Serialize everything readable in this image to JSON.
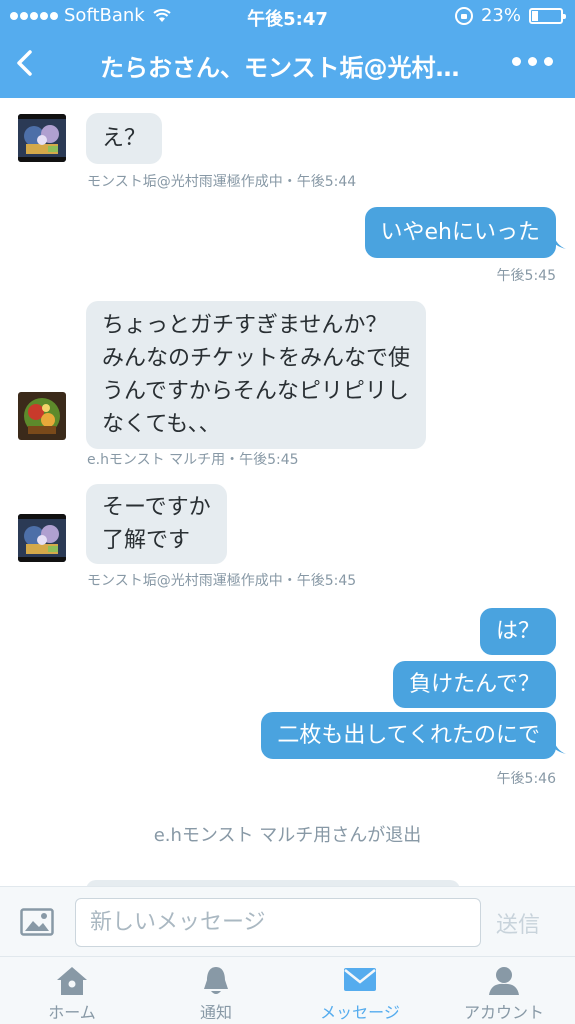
{
  "status_bar": {
    "carrier": "SoftBank",
    "time": "午後5:47",
    "battery_percent": "23%",
    "battery_level": 0.23
  },
  "header": {
    "title": "たらおさん、モンスト垢@光村雨運極作成中"
  },
  "messages": [
    {
      "text": "え？",
      "meta": "モンスト垢@光村雨運極作成中・午後5:44"
    },
    {
      "text": "いやehにいった",
      "meta": "午後5:45"
    },
    {
      "lines": [
        "ちょっとガチすぎませんか？",
        "みんなのチケットをみんなで使",
        "うんですからそんなピリピリし",
        "なくても、、"
      ],
      "meta": "e.hモンスト マルチ用・午後5:45"
    },
    {
      "lines": [
        "そーですか",
        "了解です"
      ],
      "meta": "モンスト垢@光村雨運極作成中・午後5:45"
    },
    {
      "text": "は？"
    },
    {
      "text": "負けたんで？"
    },
    {
      "text": "二枚も出してくれたのにで",
      "meta": "午後5:46"
    }
  ],
  "system_message": "e.hモンスト マルチ用さんが退出",
  "composer": {
    "placeholder": "新しいメッセージ",
    "send_label": "送信"
  },
  "tabs": [
    {
      "label": "ホーム",
      "icon": "home-icon"
    },
    {
      "label": "通知",
      "icon": "bell-icon"
    },
    {
      "label": "メッセージ",
      "icon": "envelope-icon",
      "active": true
    },
    {
      "label": "アカウント",
      "icon": "person-icon"
    }
  ],
  "colors": {
    "brand": "#55acee",
    "outgoing_bubble": "#4aa3df",
    "incoming_bubble": "#e6ecf0"
  }
}
